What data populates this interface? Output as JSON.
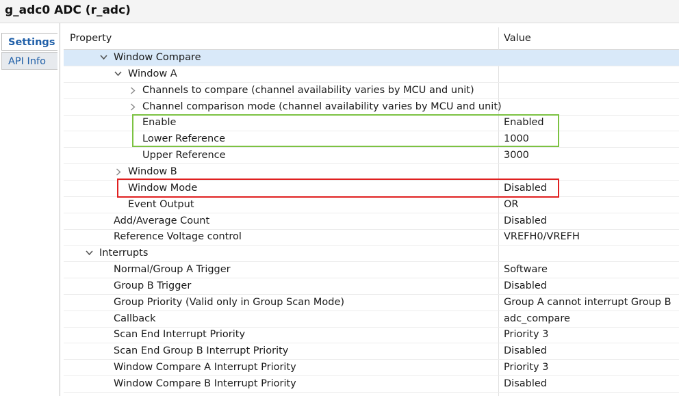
{
  "window": {
    "title": "g_adc0 ADC (r_adc)"
  },
  "tabs": [
    {
      "label": "Settings",
      "active": true
    },
    {
      "label": "API Info",
      "active": false
    }
  ],
  "columns": {
    "property": "Property",
    "value": "Value"
  },
  "rows": [
    {
      "label": "Window Compare",
      "value": "",
      "level": 1,
      "toggle": "expanded",
      "selected": true
    },
    {
      "label": "Window A",
      "value": "",
      "level": 2,
      "toggle": "expanded"
    },
    {
      "label": "Channels to compare (channel availability varies by MCU and unit)",
      "value": "",
      "level": 3,
      "toggle": "collapsed"
    },
    {
      "label": "Channel comparison mode (channel availability varies by MCU and unit)",
      "value": "",
      "level": 3,
      "toggle": "collapsed"
    },
    {
      "label": "Enable",
      "value": "Enabled",
      "level": 3,
      "toggle": "none"
    },
    {
      "label": "Lower Reference",
      "value": "1000",
      "level": 3,
      "toggle": "none"
    },
    {
      "label": "Upper Reference",
      "value": "3000",
      "level": 3,
      "toggle": "none"
    },
    {
      "label": "Window B",
      "value": "",
      "level": 2,
      "toggle": "collapsed"
    },
    {
      "label": "Window Mode",
      "value": "Disabled",
      "level": 2,
      "toggle": "none"
    },
    {
      "label": "Event Output",
      "value": "OR",
      "level": 2,
      "toggle": "none"
    },
    {
      "label": "Add/Average Count",
      "value": "Disabled",
      "level": 1,
      "toggle": "none"
    },
    {
      "label": "Reference Voltage control",
      "value": "VREFH0/VREFH",
      "level": 1,
      "toggle": "none"
    },
    {
      "label": "Interrupts",
      "value": "",
      "level": 0,
      "toggle": "expanded"
    },
    {
      "label": "Normal/Group A Trigger",
      "value": "Software",
      "level": 1,
      "toggle": "none"
    },
    {
      "label": "Group B Trigger",
      "value": "Disabled",
      "level": 1,
      "toggle": "none"
    },
    {
      "label": "Group Priority (Valid only in Group Scan Mode)",
      "value": "Group A cannot interrupt Group B",
      "level": 1,
      "toggle": "none"
    },
    {
      "label": "Callback",
      "value": "adc_compare",
      "level": 1,
      "toggle": "none"
    },
    {
      "label": "Scan End Interrupt Priority",
      "value": "Priority 3",
      "level": 1,
      "toggle": "none"
    },
    {
      "label": "Scan End Group B Interrupt Priority",
      "value": "Disabled",
      "level": 1,
      "toggle": "none"
    },
    {
      "label": "Window Compare A Interrupt Priority",
      "value": "Priority 3",
      "level": 1,
      "toggle": "none"
    },
    {
      "label": "Window Compare B Interrupt Priority",
      "value": "Disabled",
      "level": 1,
      "toggle": "none"
    }
  ],
  "highlights": {
    "green_color": "#7cc242",
    "red_color": "#e02020"
  },
  "colors": {
    "selected_row": "#d9e9f9",
    "tab_text": "#1f5fa8"
  }
}
